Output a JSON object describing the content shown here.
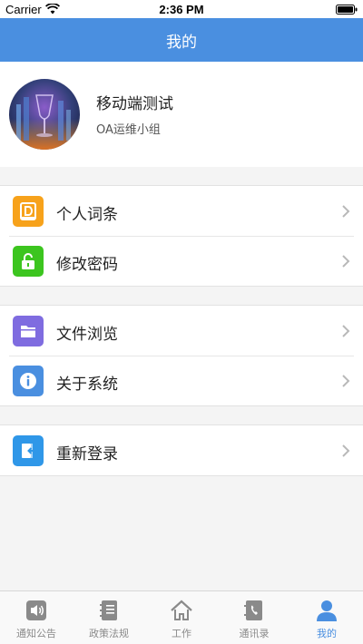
{
  "status_bar": {
    "carrier": "Carrier",
    "time": "2:36 PM"
  },
  "header": {
    "title": "我的"
  },
  "profile": {
    "name": "移动端测试",
    "group": "OA运维小组"
  },
  "menu": {
    "group1": [
      {
        "label": "个人词条",
        "icon": "dictionary-icon",
        "color": "#f7a21b"
      },
      {
        "label": "修改密码",
        "icon": "lock-icon",
        "color": "#3cc51f"
      }
    ],
    "group2": [
      {
        "label": "文件浏览",
        "icon": "folder-icon",
        "color": "#7f6ce0"
      },
      {
        "label": "关于系统",
        "icon": "info-icon",
        "color": "#4a8fe0"
      }
    ],
    "group3": [
      {
        "label": "重新登录",
        "icon": "logout-icon",
        "color": "#2f97e8"
      }
    ]
  },
  "tabs": [
    {
      "label": "通知公告",
      "icon": "speaker-icon",
      "active": false
    },
    {
      "label": "政策法规",
      "icon": "notebook-icon",
      "active": false
    },
    {
      "label": "工作",
      "icon": "home-icon",
      "active": false
    },
    {
      "label": "通讯录",
      "icon": "phone-book-icon",
      "active": false
    },
    {
      "label": "我的",
      "icon": "person-icon",
      "active": true
    }
  ],
  "colors": {
    "accent": "#4a8fe0",
    "tab_inactive": "#8a8a8a",
    "background": "#f4f4f4"
  }
}
